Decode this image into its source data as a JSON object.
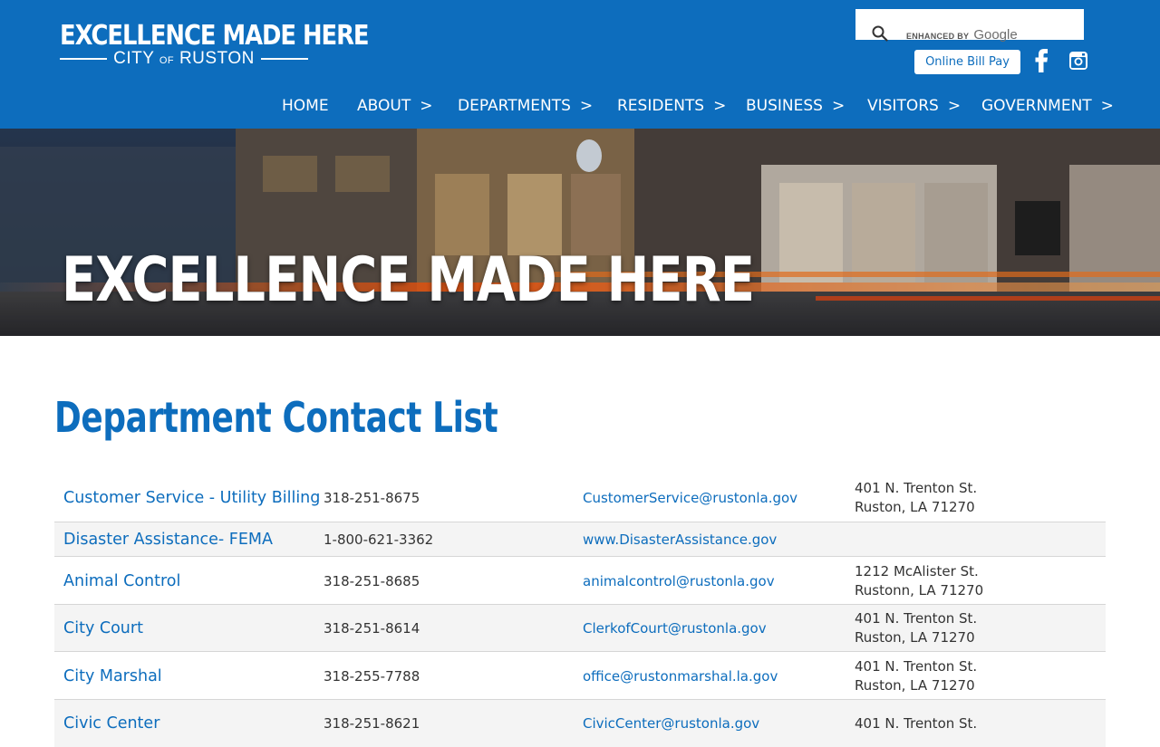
{
  "brand": {
    "logo_main": "EXCELLENCE MADE HERE",
    "logo_city": "CITY",
    "logo_of": "OF",
    "logo_ruston": "RUSTON",
    "primary_color": "#0d6dbd"
  },
  "search": {
    "enhanced_label": "ENHANCED BY",
    "provider": "Google",
    "icon": "search-icon"
  },
  "header": {
    "bill_pay_label": "Online Bill Pay",
    "social": [
      "facebook-icon",
      "instagram-icon"
    ]
  },
  "nav": {
    "items": [
      {
        "label": "HOME",
        "chevron": ""
      },
      {
        "label": "ABOUT",
        "chevron": ">"
      },
      {
        "label": "DEPARTMENTS",
        "chevron": ">"
      },
      {
        "label": "RESIDENTS",
        "chevron": ">"
      },
      {
        "label": "BUSINESS",
        "chevron": ">"
      },
      {
        "label": "VISITORS",
        "chevron": ">"
      },
      {
        "label": "GOVERNMENT",
        "chevron": ">"
      }
    ]
  },
  "hero": {
    "title": "EXCELLENCE MADE HERE"
  },
  "main": {
    "title": "Department Contact List",
    "contacts": [
      {
        "name": "Customer Service - Utility Billing",
        "phone": "318-251-8675",
        "email": "CustomerService@rustonla.gov",
        "address_line1": "401 N. Trenton St.",
        "address_line2": "Ruston, LA 71270"
      },
      {
        "name": "Disaster Assistance- FEMA",
        "phone": "1-800-621-3362",
        "email": "www.DisasterAssistance.gov",
        "address_line1": "",
        "address_line2": ""
      },
      {
        "name": "Animal Control",
        "phone": "318-251-8685",
        "email": "animalcontrol@rustonla.gov",
        "address_line1": "1212 McAlister St.",
        "address_line2": "Rustonn, LA  71270"
      },
      {
        "name": "City Court",
        "phone": "318-251-8614",
        "email": "ClerkofCourt@rustonla.gov",
        "address_line1": "401 N. Trenton St.",
        "address_line2": "Ruston, LA 71270"
      },
      {
        "name": "City Marshal",
        "phone": "318-255-7788",
        "email": "office@rustonmarshal.la.gov",
        "address_line1": "401 N. Trenton St.",
        "address_line2": "Ruston, LA  71270"
      },
      {
        "name": "Civic Center",
        "phone": "318-251-8621",
        "email": "CivicCenter@rustonla.gov",
        "address_line1": "401 N. Trenton St.",
        "address_line2": ""
      }
    ]
  }
}
